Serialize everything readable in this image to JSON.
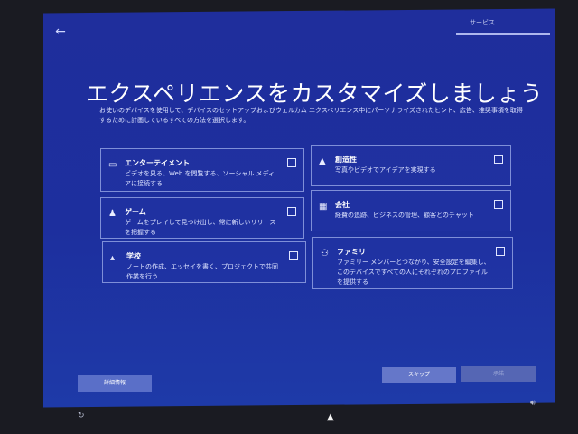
{
  "header": {
    "service_label": "サービス"
  },
  "title": "エクスペリエンスをカスタマイズしましょう",
  "subtitle": "お使いのデバイスを使用して、デバイスのセットアップおよびウェルカム エクスペリエンス中にパーソナライズされたヒント、広告、推奨事項を取得するために計画しているすべての方法を選択します。",
  "options": [
    {
      "title": "エンターテイメント",
      "desc": "ビデオを見る、Web を閲覧する、ソーシャル メディアに接続する",
      "icon": "entertainment-icon"
    },
    {
      "title": "創造性",
      "desc": "写真やビデオでアイデアを実現する",
      "icon": "creativity-icon"
    },
    {
      "title": "ゲーム",
      "desc": "ゲームをプレイして見つけ出し、常に新しいリリースを把握する",
      "icon": "gaming-icon"
    },
    {
      "title": "会社",
      "desc": "経費の追跡、ビジネスの管理、顧客とのチャット",
      "icon": "business-icon"
    },
    {
      "title": "学校",
      "desc": "ノートの作成、エッセイを書く、プロジェクトで共同作業を行う",
      "icon": "school-icon"
    },
    {
      "title": "ファミリ",
      "desc": "ファミリー メンバーとつながり、安全設定を編集し、このデバイスですべての人にそれぞれのプロファイルを提供する",
      "icon": "family-icon"
    }
  ],
  "buttons": {
    "detail": "詳細情報",
    "skip": "スキップ",
    "accept": "承諾"
  }
}
